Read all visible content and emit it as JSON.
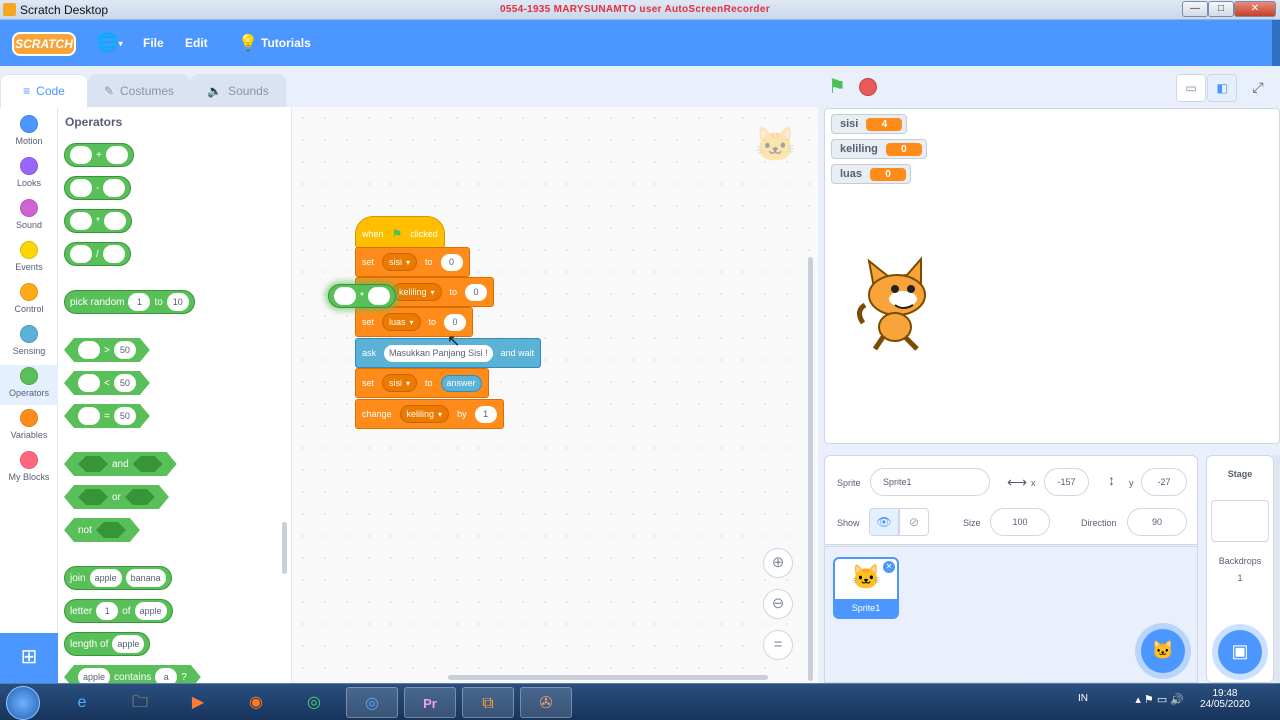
{
  "window": {
    "title": "Scratch Desktop",
    "recorder_text": "0554-1935 MARYSUNAMTO  user  AutoScreenRecorder",
    "minimize": "—",
    "maximize": "□",
    "close": "✕"
  },
  "menubar": {
    "logo": "SCRATCH",
    "file": "File",
    "edit": "Edit",
    "tutorials": "Tutorials"
  },
  "tabs": {
    "code": "Code",
    "costumes": "Costumes",
    "sounds": "Sounds"
  },
  "categories": [
    {
      "label": "Motion",
      "color": "#4c97ff"
    },
    {
      "label": "Looks",
      "color": "#9966ff"
    },
    {
      "label": "Sound",
      "color": "#cf63cf"
    },
    {
      "label": "Events",
      "color": "#ffd500"
    },
    {
      "label": "Control",
      "color": "#ffab19"
    },
    {
      "label": "Sensing",
      "color": "#5cb1d6"
    },
    {
      "label": "Operators",
      "color": "#59c059"
    },
    {
      "label": "Variables",
      "color": "#ff8c1a"
    },
    {
      "label": "My Blocks",
      "color": "#ff6680"
    }
  ],
  "palette": {
    "heading": "Operators",
    "op_add": "+",
    "op_sub": "-",
    "op_mul": "*",
    "op_div": "/",
    "pick_random": "pick random",
    "pick_from": "1",
    "pick_to_label": "to",
    "pick_to": "10",
    "gt": ">",
    "lt": "<",
    "eq": "=",
    "cmp_value": "50",
    "and": "and",
    "or": "or",
    "not": "not",
    "join": "join",
    "join_a": "apple",
    "join_b": "banana",
    "letter": "letter",
    "letter_n": "1",
    "of": "of",
    "letter_s": "apple",
    "length_of": "length of",
    "length_s": "apple",
    "contains_a": "apple",
    "contains": "contains",
    "contains_b": "a",
    "contains_q": "?"
  },
  "script": {
    "hat_when": "when",
    "hat_clicked": "clicked",
    "set": "set",
    "to": "to",
    "ask": "ask",
    "and_wait": "and wait",
    "change": "change",
    "by": "by",
    "var_sisi": "sisi",
    "var_keliling": "keliling",
    "var_luas": "luas",
    "val_zero": "0",
    "ask_text": "Masukkan Panjang Sisi !",
    "answer": "answer",
    "change_by": "1",
    "dragged_op": "*"
  },
  "monitors": [
    {
      "name": "sisi",
      "value": "4"
    },
    {
      "name": "keliling",
      "value": "0"
    },
    {
      "name": "luas",
      "value": "0"
    }
  ],
  "sprite_info": {
    "sprite_label": "Sprite",
    "sprite_name": "Sprite1",
    "x_label": "x",
    "x": "-157",
    "y_label": "y",
    "y": "-27",
    "show_label": "Show",
    "size_label": "Size",
    "size": "100",
    "direction_label": "Direction",
    "direction": "90"
  },
  "sprite_tile": "Sprite1",
  "stage_panel": {
    "title": "Stage",
    "backdrops_label": "Backdrops",
    "backdrops_count": "1"
  },
  "tray": {
    "lang": "IN",
    "time": "19:48",
    "date": "24/05/2020"
  },
  "colors": {
    "accent": "#4c97ff",
    "operators": "#59c059",
    "variables": "#ff8c1a",
    "events": "#ffbf00",
    "sensing": "#5cb1d6"
  }
}
